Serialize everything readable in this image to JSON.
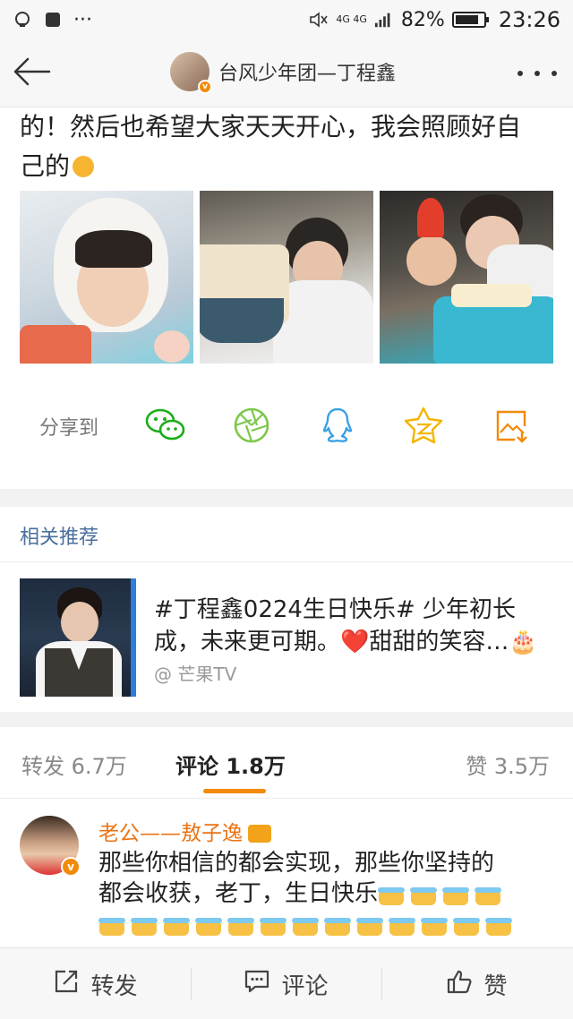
{
  "status_bar": {
    "battery_percent": "82%",
    "battery_level": 0.82,
    "network": "4G 4G",
    "time": "23:26"
  },
  "header": {
    "title": "台风少年团—丁程鑫",
    "back_icon": "arrow-left-icon",
    "more_icon": "more-dots-icon"
  },
  "post": {
    "lines": [
      "的！然后也希望大家天天开心，我会照顾好自",
      "己的"
    ]
  },
  "share": {
    "label": "分享到",
    "targets": [
      "wechat-icon",
      "moments-icon",
      "qq-icon",
      "qzone-icon",
      "save-image-icon"
    ],
    "colors": {
      "green": "#1aad19",
      "lightgreen": "#7cc84a",
      "blue": "#3ba0e6",
      "yellow": "#f4b400",
      "orange": "#f28a0a"
    }
  },
  "related": {
    "section_title": "相关推荐",
    "card": {
      "text_line1": "#丁程鑫0224生日快乐# 少年初长",
      "text_line2": "成，未来更可期。❤️甜甜的笑容…🎂",
      "source": "@ 芒果TV"
    }
  },
  "tabs": {
    "repost": "转发 6.7万",
    "comment": "评论 1.8万",
    "like": "赞 3.5万"
  },
  "comment": {
    "author": "老公——敖子逸",
    "line1": "那些你相信的都会实现，那些你坚持的",
    "line2": "都会收获，老丁，生日快乐",
    "cakes_line2": 4,
    "cakes_line3": 13
  },
  "bottom_bar": {
    "repost": "转发",
    "comment": "评论",
    "like": "赞"
  },
  "accent": "#f28a0a"
}
